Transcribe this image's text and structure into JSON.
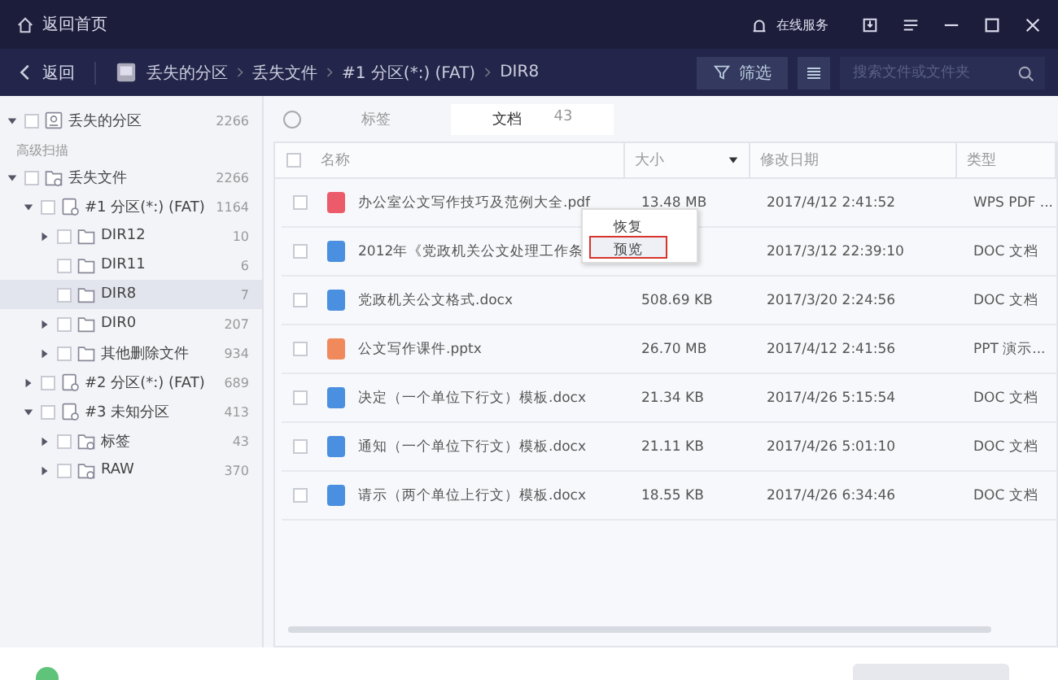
{
  "title_bar": {
    "home_link": "返回首页",
    "service": "在线服务"
  },
  "nav_bar": {
    "back": "返回",
    "breadcrumb": [
      "丢失的分区",
      "丢失文件",
      "#1 分区(*:) (FAT)",
      "DIR8"
    ],
    "filter": "筛选",
    "search": {
      "placeholder": "搜索文件或文件夹"
    }
  },
  "sidebar": {
    "top_item": {
      "label": "丢失的分区",
      "count": "2266",
      "kind": "drive",
      "expandable": true,
      "expanded": true,
      "checked": false
    },
    "section_label": "高级扫描",
    "tree": [
      {
        "label": "丢失文件",
        "count": "2266",
        "kind": "lost",
        "expandable": true,
        "expanded": true,
        "checked": false,
        "selected": false,
        "children": [
          {
            "label": "#1 分区(*:) (FAT)",
            "count": "1164",
            "kind": "partition",
            "expandable": true,
            "expanded": true,
            "checked": false,
            "selected": false,
            "children": [
              {
                "label": "DIR12",
                "count": "10",
                "kind": "folder",
                "expandable": true,
                "expanded": false,
                "checked": false,
                "selected": false
              },
              {
                "label": "DIR11",
                "count": "6",
                "kind": "folder",
                "expandable": false,
                "checked": false,
                "selected": false
              },
              {
                "label": "DIR8",
                "count": "7",
                "kind": "folder",
                "expandable": false,
                "checked": false,
                "selected": true
              },
              {
                "label": "DIR0",
                "count": "207",
                "kind": "folder",
                "expandable": true,
                "expanded": false,
                "checked": false,
                "selected": false
              },
              {
                "label": "其他删除文件",
                "count": "934",
                "kind": "folder",
                "expandable": true,
                "expanded": false,
                "checked": false,
                "selected": false
              }
            ]
          },
          {
            "label": "#2 分区(*:) (FAT)",
            "count": "689",
            "kind": "partition",
            "expandable": true,
            "expanded": false,
            "checked": false,
            "selected": false
          },
          {
            "label": "#3 未知分区",
            "count": "413",
            "kind": "partition",
            "expandable": true,
            "expanded": true,
            "checked": false,
            "selected": false,
            "children": [
              {
                "label": "标签",
                "count": "43",
                "kind": "lost",
                "expandable": true,
                "expanded": false,
                "checked": false,
                "selected": false
              },
              {
                "label": "RAW",
                "count": "370",
                "kind": "lost",
                "expandable": true,
                "expanded": false,
                "checked": false,
                "selected": false
              }
            ]
          }
        ]
      }
    ]
  },
  "tabs": [
    {
      "label": "标签",
      "selected": false
    },
    {
      "label": "文档",
      "count": "43",
      "selected": true
    }
  ],
  "table": {
    "select_all_checked": false,
    "columns": [
      {
        "label": "名称",
        "sorted": false
      },
      {
        "label": "大小",
        "sorted": true
      },
      {
        "label": "修改日期",
        "sorted": false
      },
      {
        "label": "类型",
        "sorted": false
      }
    ],
    "rows": [
      {
        "kind": "pdf",
        "name": "办公室公文写作技巧及范例大全.pdf",
        "size": "13.48 MB",
        "date": "2017/4/12 2:41:52",
        "type": "WPS PDF ...",
        "checked": false
      },
      {
        "kind": "word",
        "name": "2012年《党政机关公文处理工作条",
        "date": "2017/3/12 22:39:10",
        "type": "DOC 文档",
        "checked": false
      },
      {
        "kind": "word",
        "name": "党政机关公文格式.docx",
        "size": "508.69 KB",
        "date": "2017/3/20 2:24:56",
        "type": "DOC 文档",
        "checked": false
      },
      {
        "kind": "ppt",
        "name": "公文写作课件.pptx",
        "size": "26.70 MB",
        "date": "2017/4/12 2:41:56",
        "type": "PPT 演示...",
        "checked": false
      },
      {
        "kind": "word",
        "name": "决定（一个单位下行文）模板.docx",
        "size": "21.34 KB",
        "date": "2017/4/26 5:15:54",
        "type": "DOC 文档",
        "checked": false
      },
      {
        "kind": "word",
        "name": "通知（一个单位下行文）模板.docx",
        "size": "21.11 KB",
        "date": "2017/4/26 5:01:10",
        "type": "DOC 文档",
        "checked": false
      },
      {
        "kind": "word",
        "name": "请示（两个单位上行文）模板.docx",
        "size": "18.55 KB",
        "date": "2017/4/26 6:34:46",
        "type": "DOC 文档",
        "checked": false
      }
    ]
  },
  "context_menu": [
    {
      "label": "恢复",
      "selected": false
    },
    {
      "label": "预览",
      "selected": true
    }
  ]
}
